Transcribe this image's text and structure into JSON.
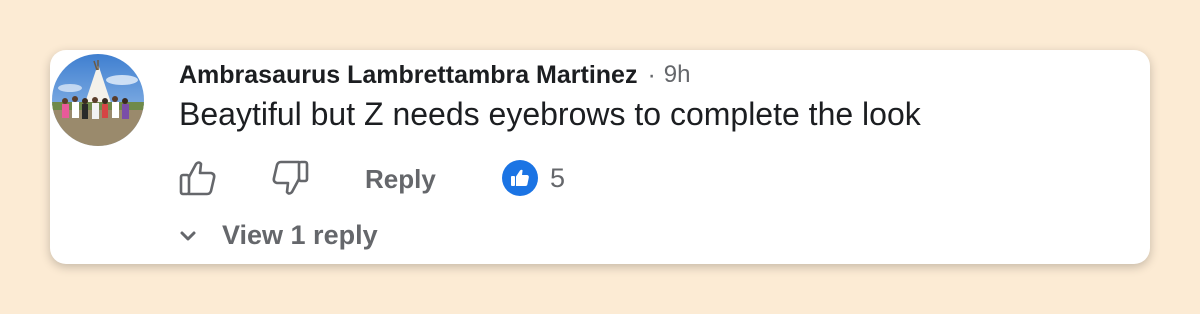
{
  "comment": {
    "author": "Ambrasaurus Lambrettambra Martinez",
    "separator": "·",
    "time": "9h",
    "text": "Beaytiful but Z needs eyebrows to complete the look",
    "avatar": "profile-photo"
  },
  "actions": {
    "like_icon": "thumbs-up-outline-icon",
    "dislike_icon": "thumbs-down-outline-icon",
    "reply_label": "Reply",
    "reaction_icon": "like-reaction-icon",
    "reaction_count": "5"
  },
  "replies": {
    "icon": "chevron-down-icon",
    "label": "View 1 reply"
  },
  "colors": {
    "page_background": "#fcebd4",
    "card_background": "#ffffff",
    "text_primary": "#1c1e21",
    "text_secondary": "#65676b",
    "like_blue": "#1b74e4"
  }
}
